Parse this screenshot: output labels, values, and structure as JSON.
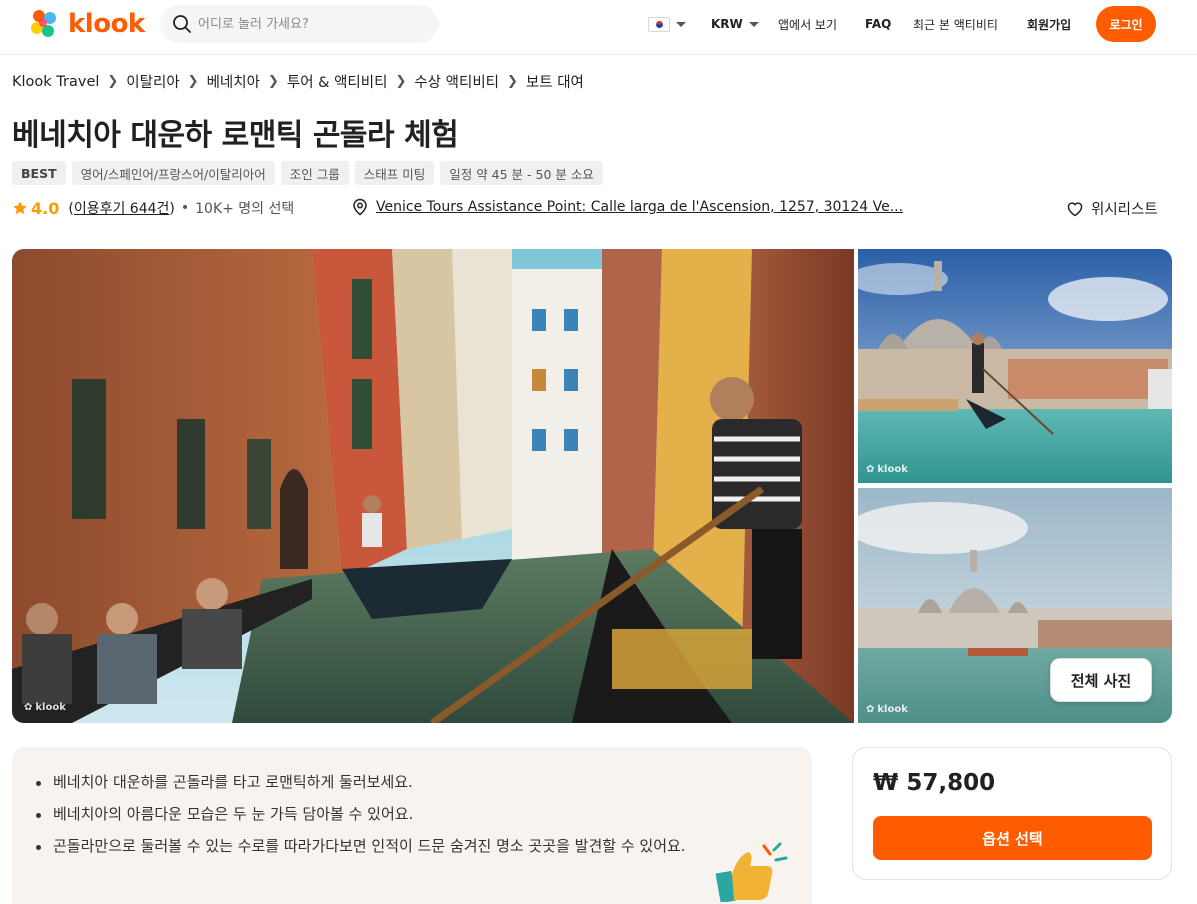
{
  "header": {
    "logo_text": "klook",
    "search_placeholder": "어디로 놀러 가세요?",
    "currency": "KRW",
    "app_link": "앱에서 보기",
    "faq": "FAQ",
    "recent": "최근 본 액티비티",
    "signup": "회원가입",
    "login": "로그인",
    "brand_color": "#ff5b00"
  },
  "breadcrumb": [
    "Klook Travel",
    "이탈리아",
    "베네치아",
    "투어 & 액티비티",
    "수상 액티비티",
    "보트 대여"
  ],
  "title": "베네치아 대운하 로맨틱 곤돌라 체험",
  "tags": [
    "BEST",
    "영어/스페인어/프랑스어/이탈리아어",
    "조인 그룹",
    "스태프 미팅",
    "일정 약 45 분  - 50 분  소요"
  ],
  "meta": {
    "rating": "4.0",
    "reviews": "이용후기 644건",
    "booked": "10K+ 명의 선택",
    "location": "Venice Tours Assistance Point: Calle larga de l'Ascension, 1257, 30124 Ve...",
    "wishlist": "위시리스트"
  },
  "gallery": {
    "watermark": "klook",
    "all_photos": "전체 사진"
  },
  "highlights": [
    "베네치아 대운하를 곤돌라를 타고 로맨틱하게 둘러보세요.",
    "베네치아의 아름다운 모습은 두 눈 가득 담아볼 수 있어요.",
    "곤돌라만으로 둘러볼 수 있는 수로를 따라가다보면 인적이 드문 숨겨진 명소 곳곳을 발견할 수 있어요."
  ],
  "price": {
    "amount": "₩ 57,800",
    "button": "옵션 선택"
  }
}
